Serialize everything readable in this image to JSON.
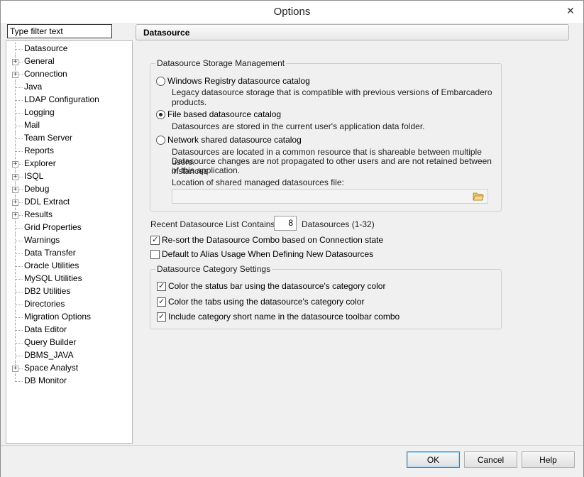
{
  "window": {
    "title": "Options",
    "close_glyph": "✕"
  },
  "filter": {
    "placeholder": "Type filter text",
    "value": "Type filter text"
  },
  "tree": {
    "items": [
      {
        "label": "Datasource",
        "expandable": false,
        "selected": true
      },
      {
        "label": "General",
        "expandable": true
      },
      {
        "label": "Connection",
        "expandable": true
      },
      {
        "label": "Java",
        "expandable": false
      },
      {
        "label": "LDAP Configuration",
        "expandable": false
      },
      {
        "label": "Logging",
        "expandable": false
      },
      {
        "label": "Mail",
        "expandable": false
      },
      {
        "label": "Team Server",
        "expandable": false
      },
      {
        "label": "Reports",
        "expandable": false
      },
      {
        "label": "Explorer",
        "expandable": true
      },
      {
        "label": "ISQL",
        "expandable": true
      },
      {
        "label": "Debug",
        "expandable": true
      },
      {
        "label": "DDL Extract",
        "expandable": true
      },
      {
        "label": "Results",
        "expandable": true
      },
      {
        "label": "Grid Properties",
        "expandable": false
      },
      {
        "label": "Warnings",
        "expandable": false
      },
      {
        "label": "Data Transfer",
        "expandable": false
      },
      {
        "label": "Oracle Utilities",
        "expandable": false
      },
      {
        "label": "MySQL Utilities",
        "expandable": false
      },
      {
        "label": "DB2 Utilities",
        "expandable": false
      },
      {
        "label": "Directories",
        "expandable": false
      },
      {
        "label": "Migration Options",
        "expandable": false
      },
      {
        "label": "Data Editor",
        "expandable": false
      },
      {
        "label": "Query Builder",
        "expandable": false
      },
      {
        "label": "DBMS_JAVA",
        "expandable": false
      },
      {
        "label": "Space Analyst",
        "expandable": true
      },
      {
        "label": "DB Monitor",
        "expandable": false
      }
    ]
  },
  "panel": {
    "header": "Datasource",
    "storage": {
      "legend": "Datasource Storage Management",
      "option1": {
        "label": "Windows Registry datasource catalog",
        "desc1": "Legacy datasource storage that is compatible with previous versions of Embarcadero",
        "desc2": "products.",
        "selected": false
      },
      "option2": {
        "label": "File based datasource catalog",
        "desc1": "Datasources are stored in the current user's application data folder.",
        "selected": true
      },
      "option3": {
        "label": "Network shared datasource catalog",
        "desc1": "Datasources are located in a common resource that is shareable between multiple users.",
        "desc2": "Datasource changes are not propagated to other users and are not retained between instances",
        "desc3": "of this application.",
        "selected": false
      },
      "location_label": "Location of shared managed datasources file:",
      "location_value": ""
    },
    "recent": {
      "label": "Recent Datasource List Contains:",
      "value": "8",
      "suffix": "Datasources (1-32)"
    },
    "resort": {
      "label": "Re-sort the Datasource Combo based on Connection state",
      "checked": true
    },
    "alias": {
      "label": "Default to Alias Usage When Defining New Datasources",
      "checked": false
    },
    "category": {
      "legend": "Datasource Category Settings",
      "statusbar": {
        "label": "Color the status bar using the datasource's category color",
        "checked": true
      },
      "tabs": {
        "label": "Color the tabs using the datasource's category color",
        "checked": true
      },
      "shortname": {
        "label": "Include category short name in the datasource toolbar combo",
        "checked": true
      }
    }
  },
  "buttons": {
    "ok": "OK",
    "cancel": "Cancel",
    "help": "Help"
  }
}
